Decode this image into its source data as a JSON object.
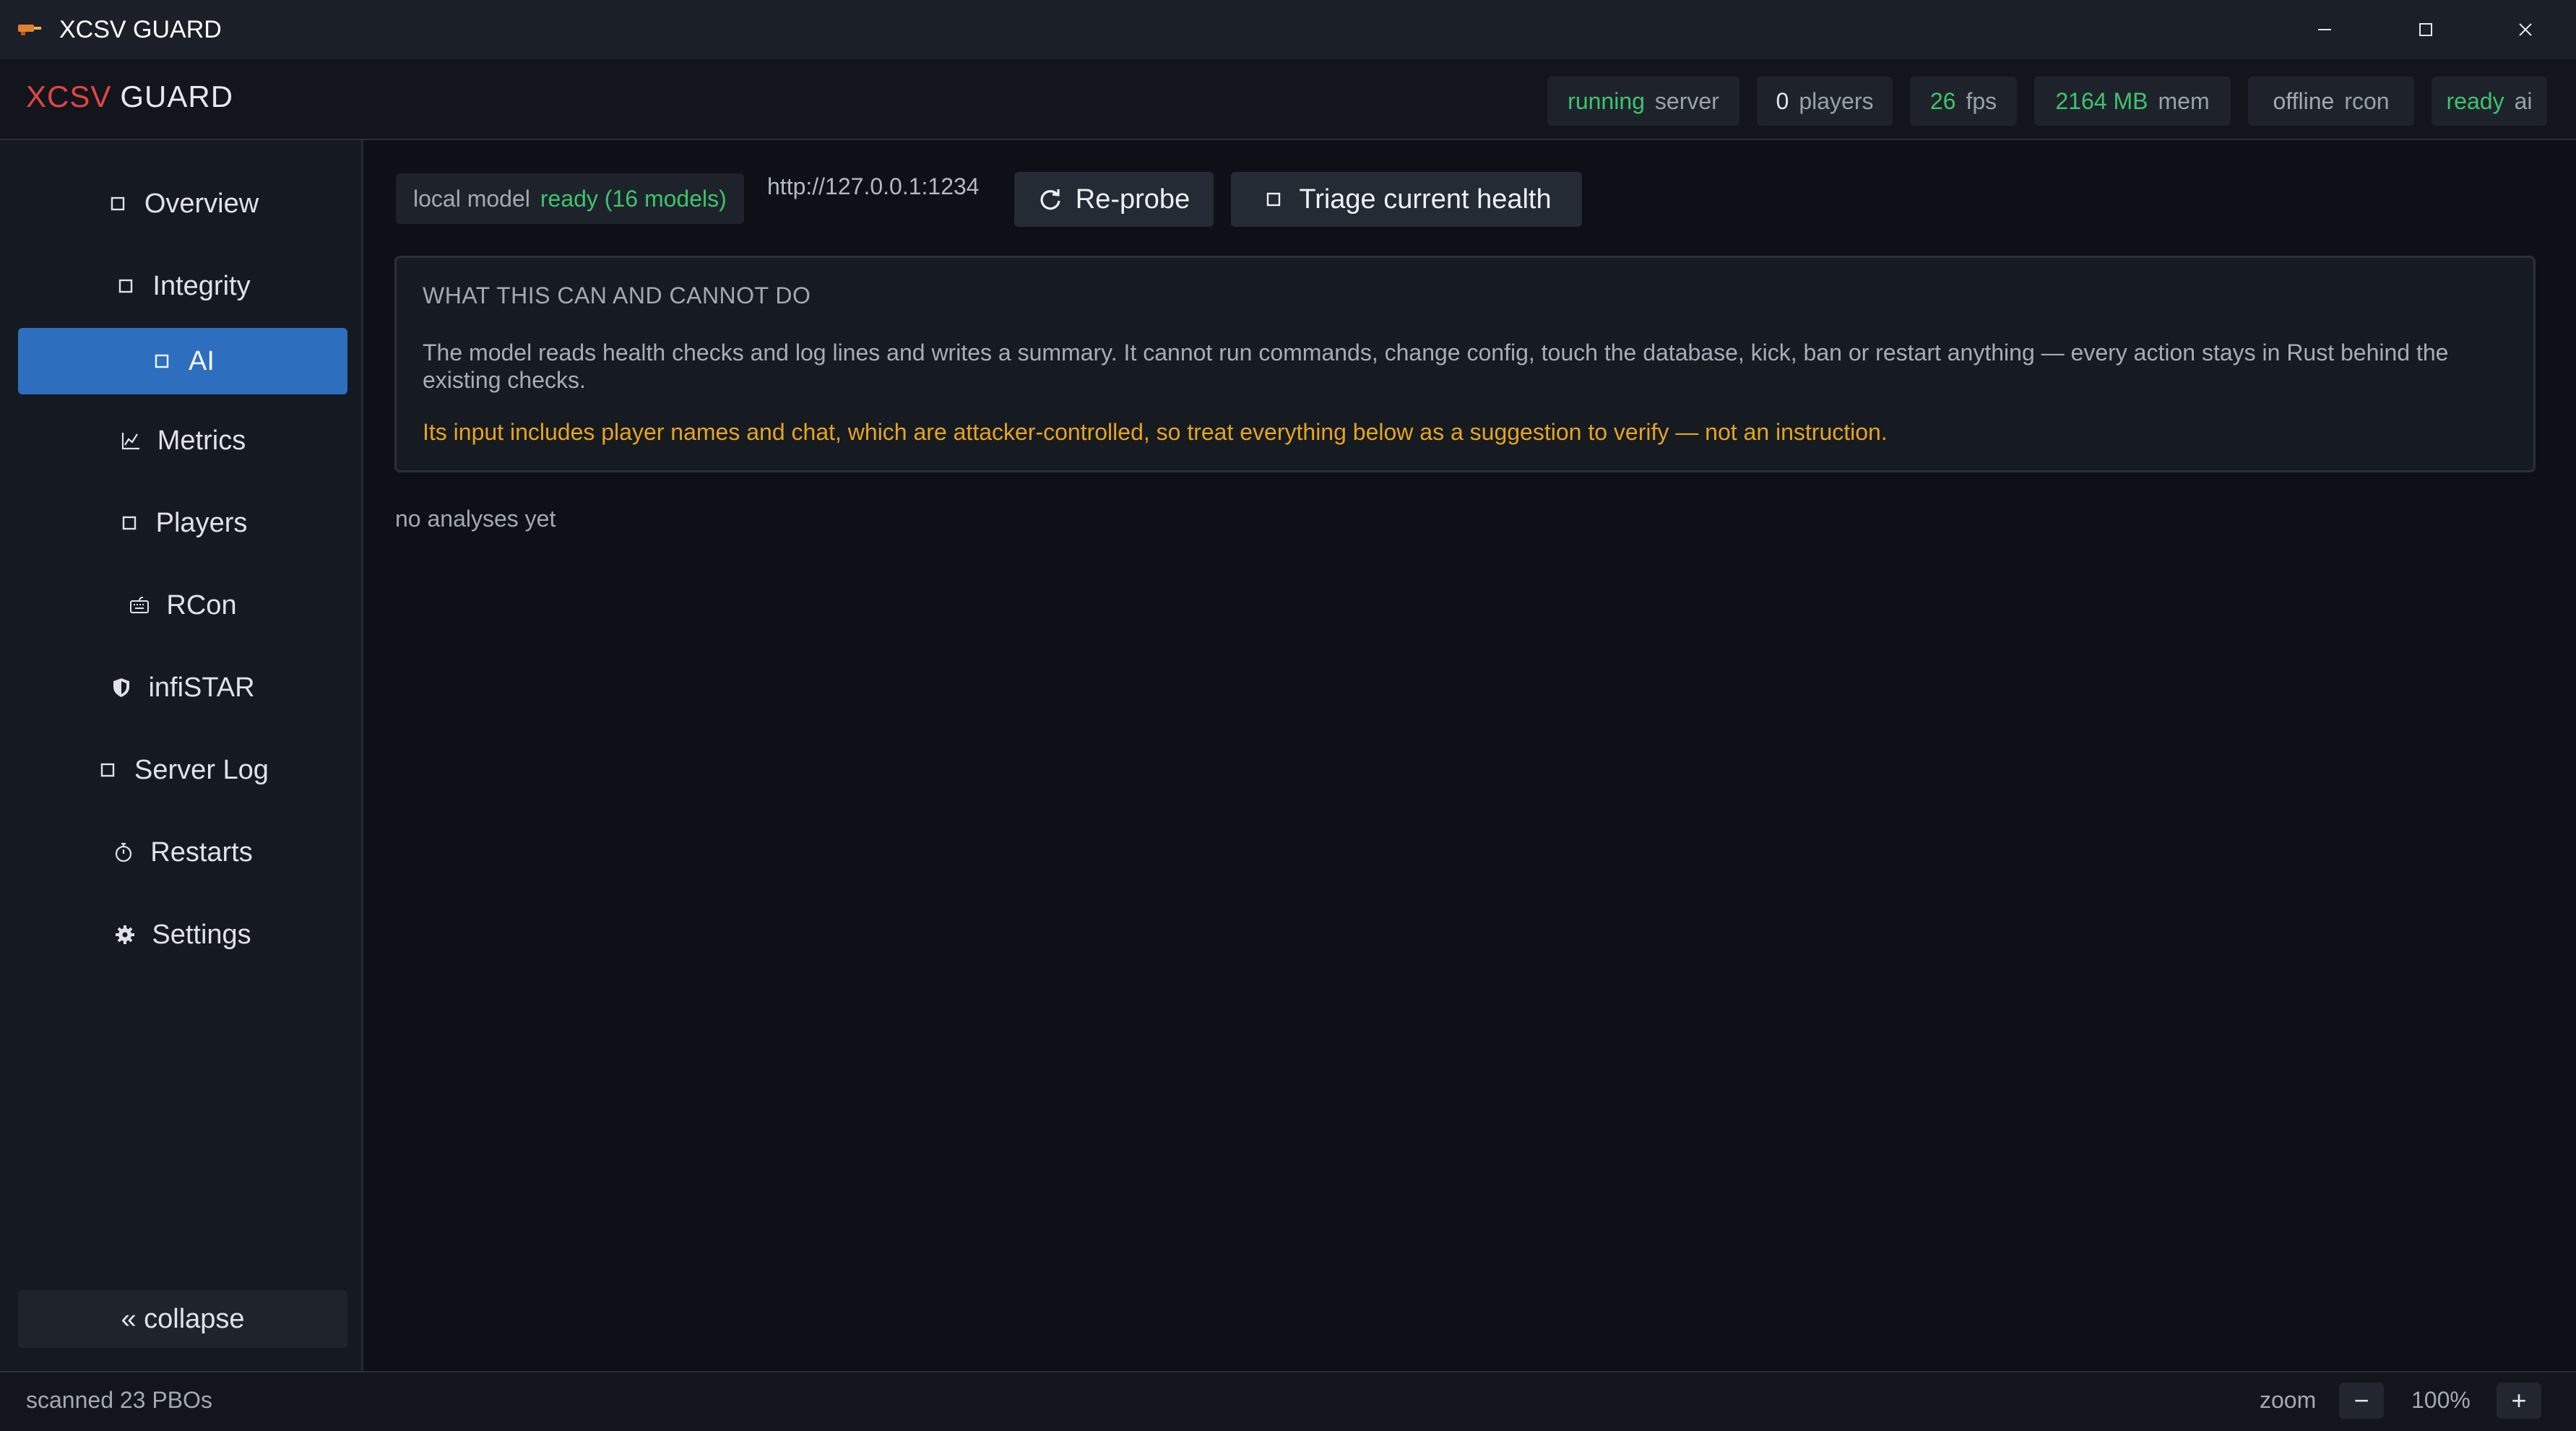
{
  "window": {
    "title": "XCSV GUARD",
    "app_icon": "guard-logo-icon"
  },
  "header": {
    "brand_primary": "XCSV",
    "brand_secondary": "GUARD",
    "brand_primary_color": "#e04545",
    "status": [
      {
        "value": "running",
        "label": "server",
        "color": "#3ec46d"
      },
      {
        "value": "0",
        "label": "players",
        "color": "#e4e7ec"
      },
      {
        "value": "26",
        "label": "fps",
        "color": "#3ec46d"
      },
      {
        "value": "2164 MB",
        "label": "mem",
        "color": "#3ec46d"
      },
      {
        "value": "offline",
        "label": "rcon",
        "color": "#a3a9b3"
      },
      {
        "value": "ready",
        "label": "ai",
        "color": "#3ec46d"
      }
    ]
  },
  "sidebar": {
    "items": [
      {
        "label": "Overview",
        "icon": "square-icon"
      },
      {
        "label": "Integrity",
        "icon": "square-icon"
      },
      {
        "label": "AI",
        "icon": "square-icon",
        "active": true
      },
      {
        "label": "Metrics",
        "icon": "chart-line-icon"
      },
      {
        "label": "Players",
        "icon": "square-icon"
      },
      {
        "label": "RCon",
        "icon": "keyboard-icon"
      },
      {
        "label": "infiSTAR",
        "icon": "shield-icon"
      },
      {
        "label": "Server Log",
        "icon": "square-icon"
      },
      {
        "label": "Restarts",
        "icon": "stopwatch-icon"
      },
      {
        "label": "Settings",
        "icon": "gear-icon"
      }
    ],
    "collapse_label": "« collapse",
    "active_color": "#2d6fbe"
  },
  "main": {
    "model": {
      "label": "local model",
      "status": "ready (16 models)"
    },
    "endpoint": "http://127.0.0.1:1234",
    "reprobe_label": "Re-probe",
    "triage_label": "Triage current health",
    "info": {
      "title": "WHAT THIS CAN AND CANNOT DO",
      "body": "The model reads health checks and log lines and writes a summary. It cannot run commands, change config, touch the database, kick, ban or restart anything — every action stays in Rust behind the existing checks.",
      "warning": "Its input includes player names and chat, which are attacker-controlled, so treat everything below as a suggestion to verify — not an instruction.",
      "warning_color": "#e5a51f"
    },
    "empty_state": "no analyses yet"
  },
  "statusbar": {
    "left": "scanned 23 PBOs",
    "zoom_label": "zoom",
    "zoom_minus": "−",
    "zoom_value": "100%",
    "zoom_plus": "+"
  }
}
